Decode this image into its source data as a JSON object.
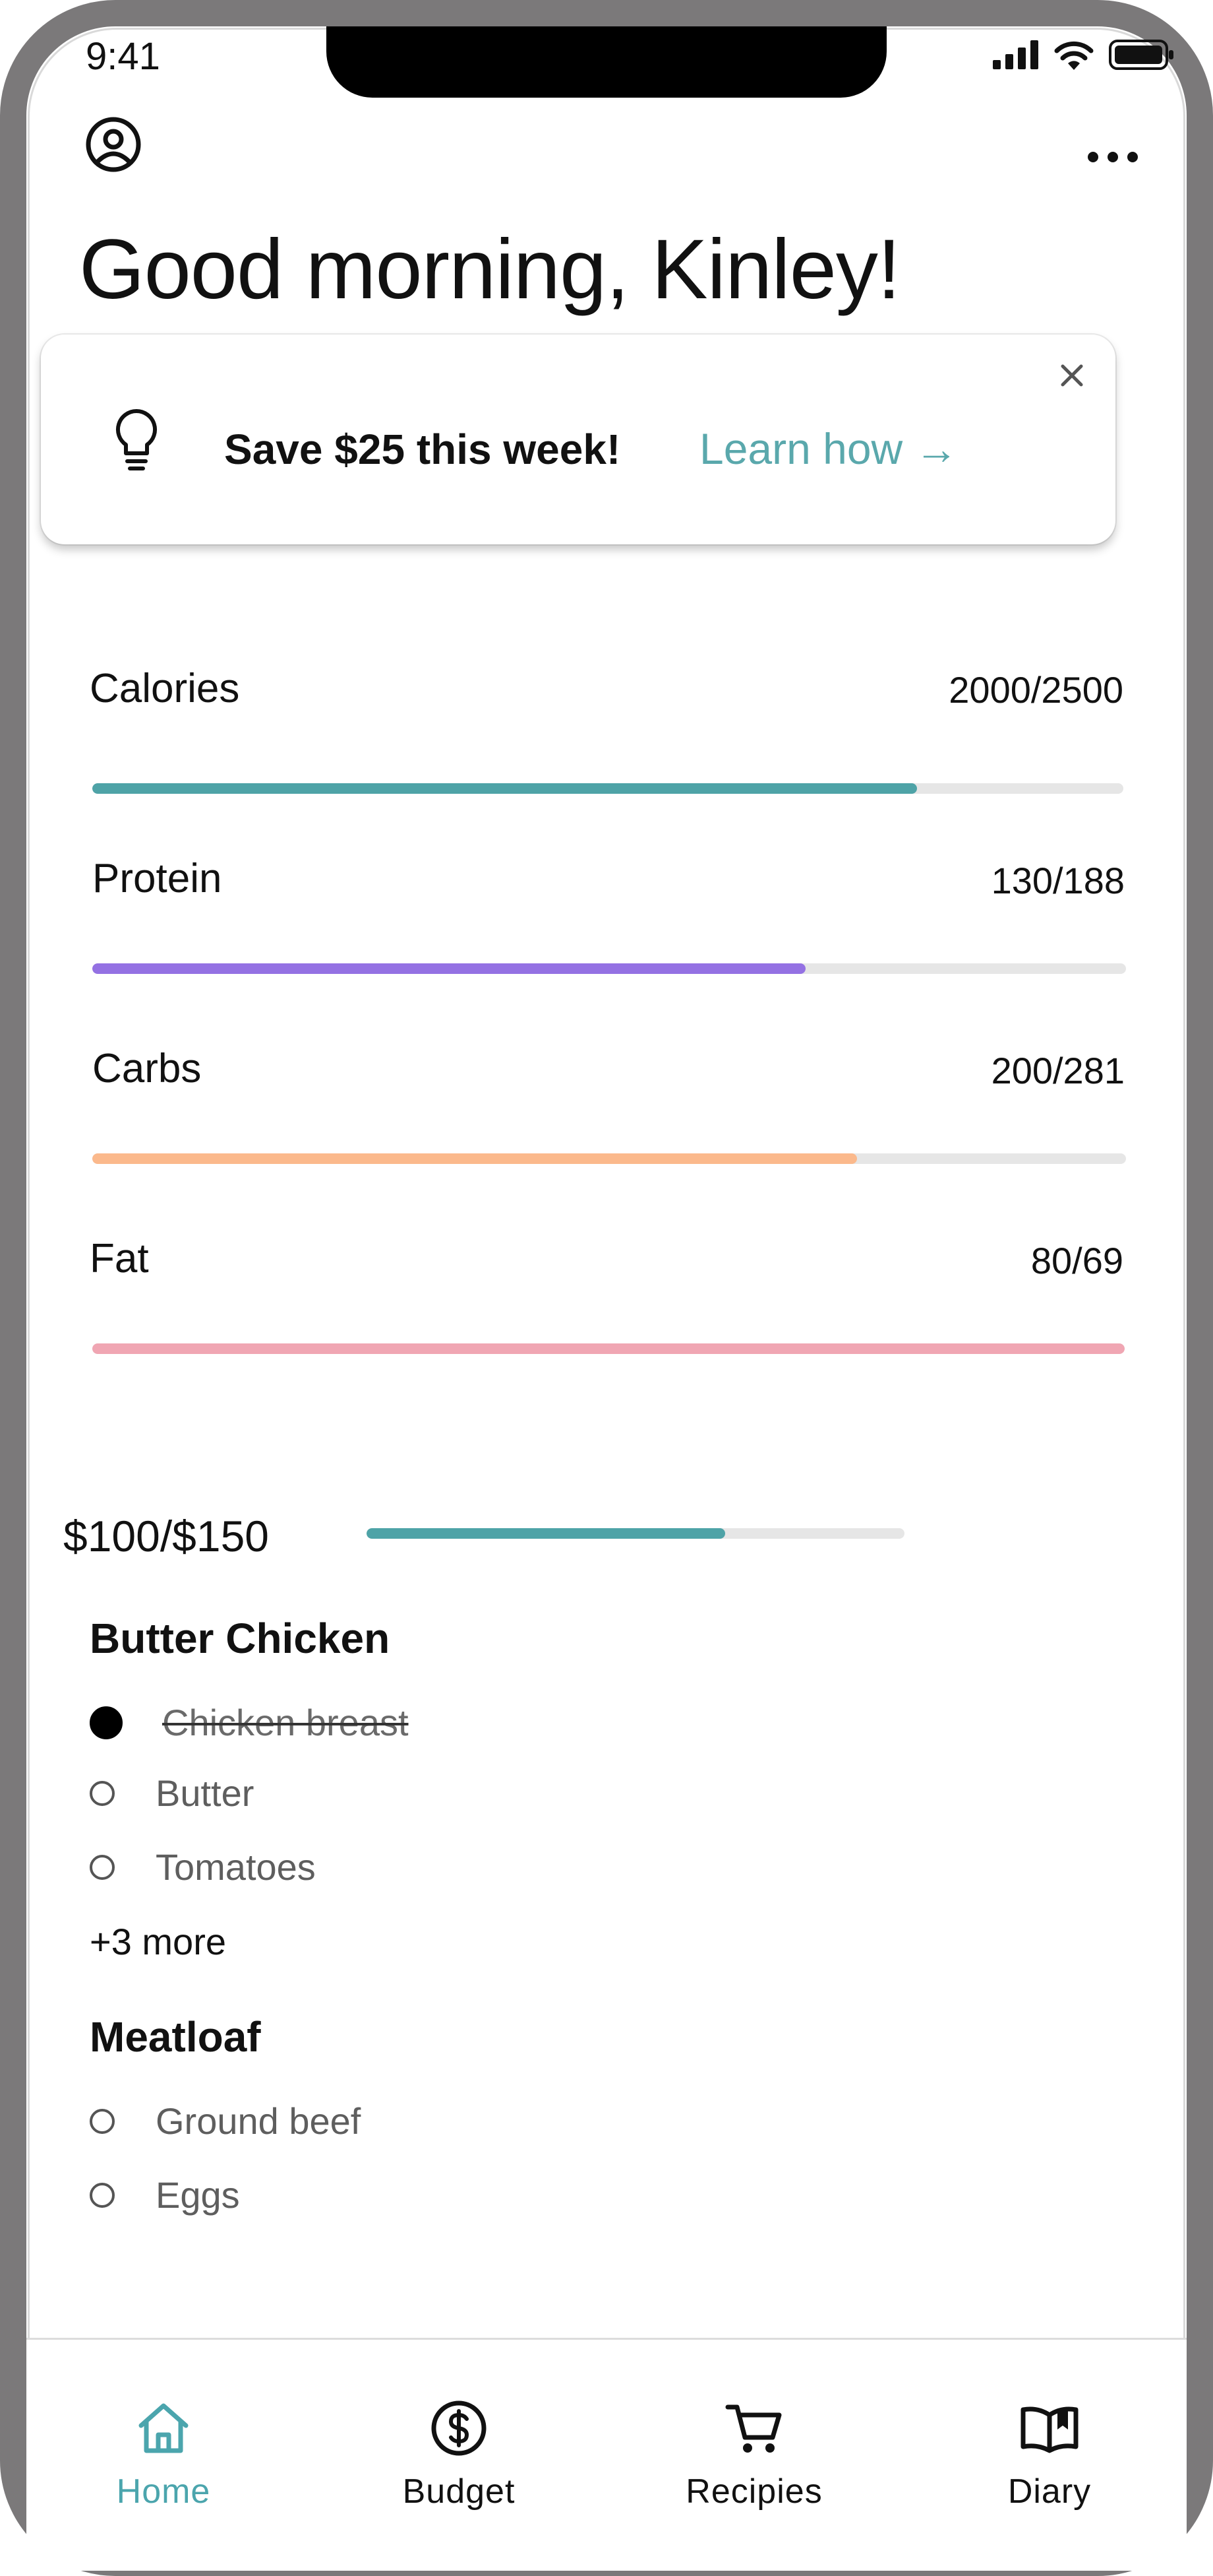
{
  "status_bar": {
    "time": "9:41"
  },
  "header": {
    "greeting": "Good morning, Kinley!"
  },
  "tip": {
    "text": "Save $25 this week!",
    "link": "Learn how →"
  },
  "macros": [
    {
      "label": "Calories",
      "value": "2000/2500",
      "progress": 0.8,
      "color": "#4ea3a7"
    },
    {
      "label": "Protein",
      "value": "130/188",
      "progress": 0.69,
      "color": "#9471e3"
    },
    {
      "label": "Carbs",
      "value": "200/281",
      "progress": 0.74,
      "color": "#fbb98c"
    },
    {
      "label": "Fat",
      "value": "80/69",
      "progress": 1.0,
      "color": "#f0a6b3"
    }
  ],
  "budget": {
    "label": "$100/$150",
    "progress": 0.667,
    "color": "#4ea3a7"
  },
  "recipes": [
    {
      "title": "Butter Chicken",
      "ingredients": [
        {
          "name": "Chicken breast",
          "checked": true
        },
        {
          "name": "Butter",
          "checked": false
        },
        {
          "name": "Tomatoes",
          "checked": false
        }
      ],
      "more": "+3 more"
    },
    {
      "title": "Meatloaf",
      "ingredients": [
        {
          "name": "Ground beef",
          "checked": false
        },
        {
          "name": "Eggs",
          "checked": false
        }
      ]
    }
  ],
  "nav": {
    "active_color": "#4ba5ad",
    "items": [
      {
        "label": "Home",
        "icon": "home-icon",
        "active": true
      },
      {
        "label": "Budget",
        "icon": "dollar-circle-icon",
        "active": false
      },
      {
        "label": "Recipies",
        "icon": "cart-icon",
        "active": false
      },
      {
        "label": "Diary",
        "icon": "book-icon",
        "active": false
      }
    ]
  }
}
